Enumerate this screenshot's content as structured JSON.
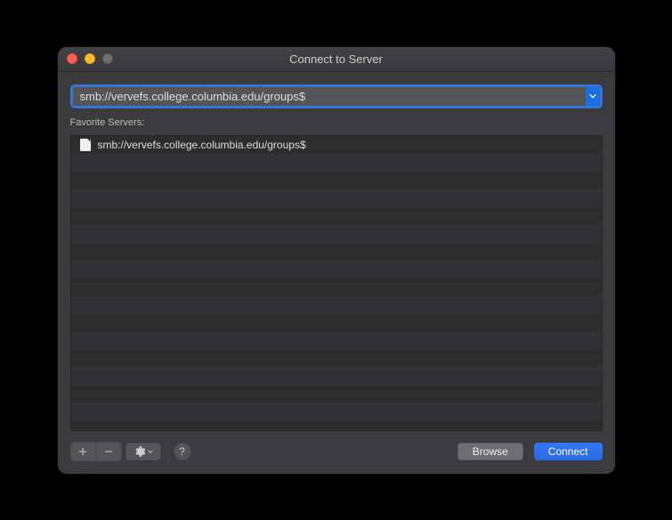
{
  "window": {
    "title": "Connect to Server"
  },
  "address": {
    "value": "smb://vervefs.college.columbia.edu/groups$"
  },
  "section": {
    "label": "Favorite Servers:"
  },
  "favorites": [
    {
      "label": "smb://vervefs.college.columbia.edu/groups$"
    }
  ],
  "buttons": {
    "browse": "Browse",
    "connect": "Connect",
    "help": "?"
  }
}
